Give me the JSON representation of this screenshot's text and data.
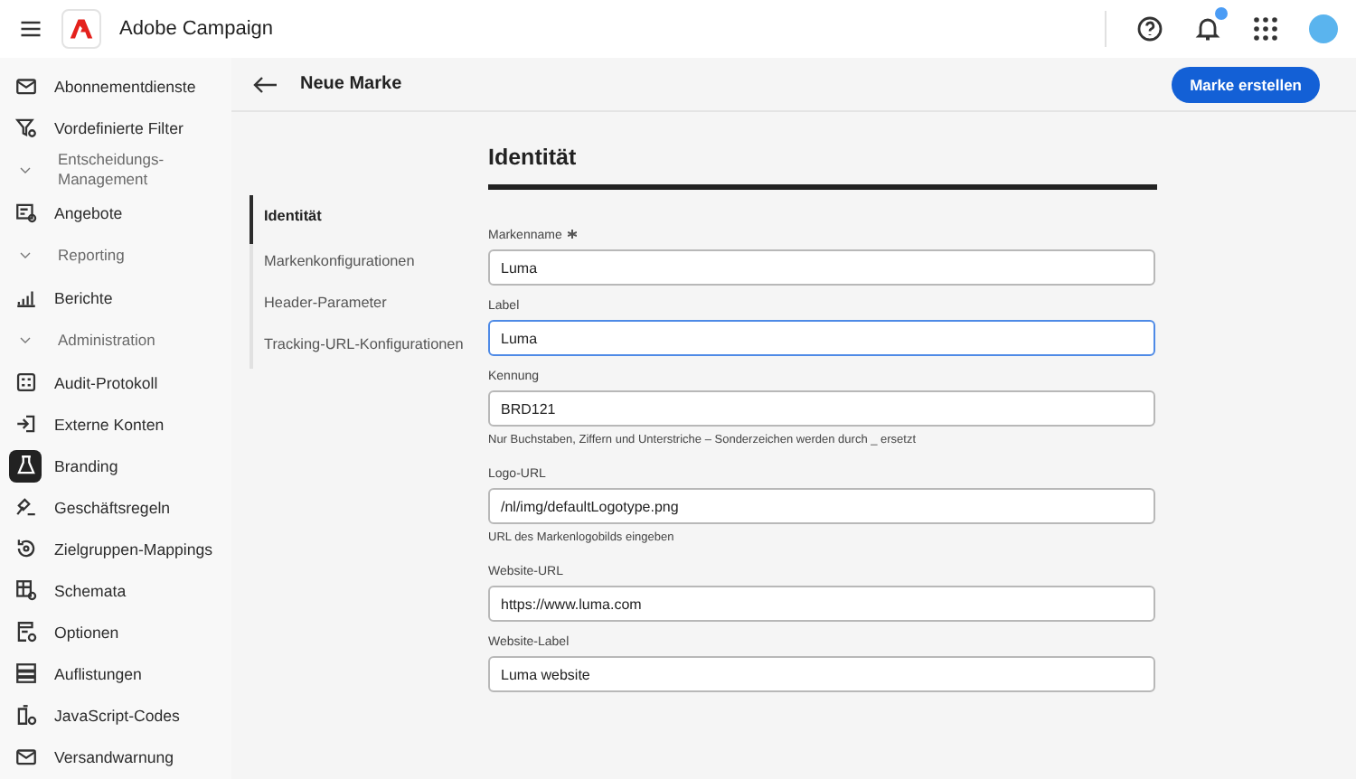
{
  "app": {
    "title": "Adobe Campaign",
    "notifications_badge": true
  },
  "sidebar": {
    "items": [
      {
        "kind": "item",
        "label": "Abonnementdienste",
        "selected": false
      },
      {
        "kind": "item",
        "label": "Vordefinierte Filter",
        "selected": false
      },
      {
        "kind": "section",
        "label": "Entscheidungs-Management",
        "expanded": true
      },
      {
        "kind": "item",
        "label": "Angebote",
        "selected": false
      },
      {
        "kind": "section",
        "label": "Reporting",
        "expanded": true
      },
      {
        "kind": "item",
        "label": "Berichte",
        "selected": false
      },
      {
        "kind": "section",
        "label": "Administration",
        "expanded": true
      },
      {
        "kind": "item",
        "label": "Audit-Protokoll",
        "selected": false
      },
      {
        "kind": "item",
        "label": "Externe Konten",
        "selected": false
      },
      {
        "kind": "item",
        "label": "Branding",
        "selected": true
      },
      {
        "kind": "item",
        "label": "Geschäftsregeln",
        "selected": false
      },
      {
        "kind": "item",
        "label": "Zielgruppen-Mappings",
        "selected": false
      },
      {
        "kind": "item",
        "label": "Schemata",
        "selected": false
      },
      {
        "kind": "item",
        "label": "Optionen",
        "selected": false
      },
      {
        "kind": "item",
        "label": "Auflistungen",
        "selected": false
      },
      {
        "kind": "item",
        "label": "JavaScript-Codes",
        "selected": false
      },
      {
        "kind": "item",
        "label": "Versandwarnung",
        "selected": false
      }
    ]
  },
  "page": {
    "title": "Neue Marke",
    "primary_button": "Marke erstellen"
  },
  "steps": [
    {
      "label": "Identität",
      "selected": true
    },
    {
      "label": "Markenkonfigurationen",
      "selected": false
    },
    {
      "label": "Header-Parameter",
      "selected": false
    },
    {
      "label": "Tracking-URL-Konfigurationen",
      "selected": false
    }
  ],
  "form": {
    "heading": "Identität",
    "fields": [
      {
        "label": "Markenname",
        "required": true,
        "value": "Luma",
        "focused": false
      },
      {
        "label": "Label",
        "required": false,
        "value": "Luma",
        "focused": true
      },
      {
        "label": "Kennung",
        "required": false,
        "value": "BRD121",
        "focused": false,
        "hint": "Nur Buchstaben, Ziffern und Unterstriche – Sonderzeichen werden durch _ ersetzt"
      },
      {
        "label": "Logo-URL",
        "required": false,
        "value": "/nl/img/defaultLogotype.png",
        "focused": false,
        "hint": "URL des Markenlogobilds eingeben"
      },
      {
        "label": "Website-URL",
        "required": false,
        "value": "https://www.luma.com",
        "focused": false
      },
      {
        "label": "Website-Label",
        "required": false,
        "value": "Luma website",
        "focused": false
      }
    ]
  }
}
